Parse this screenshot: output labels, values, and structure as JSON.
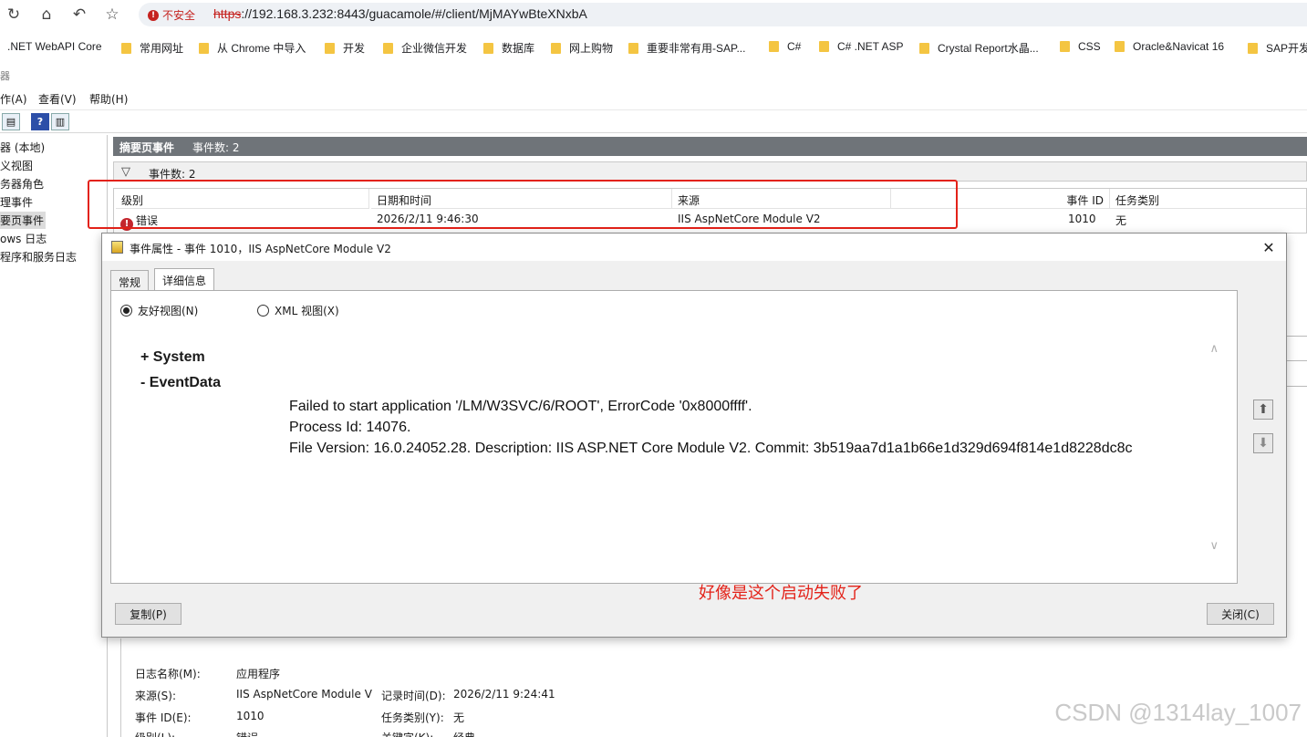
{
  "browser": {
    "insecure_label": "不安全",
    "url_scheme": "https",
    "url_rest": "://192.168.3.232:8443/guacamole/#/client/MjMAYwBteXNxbA",
    "bookmarks": [
      ".NET WebAPI Core",
      "常用网址",
      "从 Chrome 中导入",
      "开发",
      "企业微信开发",
      "数据库",
      "网上购物",
      "重要非常有用-SAP...",
      "C#",
      "C# .NET ASP",
      "Crystal Report水晶...",
      "CSS",
      "Oracle&Navicat 16",
      "SAP开发"
    ]
  },
  "event_viewer": {
    "title_fragment": "器",
    "menu": [
      "作(A)",
      "查看(V)",
      "帮助(H)"
    ],
    "tree": [
      "器 (本地)",
      "义视图",
      "务器角色",
      "理事件",
      "要页事件",
      "ows 日志",
      "程序和服务日志"
    ],
    "summary": {
      "title": "摘要页事件",
      "count_label": "事件数: 2"
    },
    "filter_text": "事件数: 2",
    "columns": [
      "级别",
      "日期和时间",
      "来源",
      "事件 ID",
      "任务类别"
    ],
    "row": {
      "level": "错误",
      "datetime": "2026/2/11 9:46:30",
      "source": "IIS AspNetCore Module V2",
      "event_id": "1010",
      "task": "无"
    }
  },
  "dialog": {
    "title": "事件属性 - 事件 1010，IIS AspNetCore Module V2",
    "tabs": [
      "常规",
      "详细信息"
    ],
    "radio_friendly": "友好视图(N)",
    "radio_xml": "XML 视图(X)",
    "node_system": "+  System",
    "node_eventdata": "-  EventData",
    "lines": [
      "Failed to start application '/LM/W3SVC/6/ROOT', ErrorCode '0x8000ffff'.",
      "Process Id: 14076.",
      "File Version: 16.0.24052.28. Description: IIS ASP.NET Core Module V2. Commit: 3b519aa7d1a1b66e1d329d694f814e1d8228dc8c"
    ],
    "copy_button": "复制(P)",
    "close_button": "关闭(C)"
  },
  "annotation": "好像是这个启动失败了",
  "preview": {
    "log_name_label": "日志名称(M):",
    "log_name_value": "应用程序",
    "source_label": "来源(S):",
    "source_value": "IIS AspNetCore Module V",
    "logged_label": "记录时间(D):",
    "logged_value": "2026/2/11 9:24:41",
    "event_id_label": "事件 ID(E):",
    "event_id_value": "1010",
    "task_label": "任务类别(Y):",
    "task_value": "无",
    "level_label": "级别(L):",
    "level_value": "错误",
    "keywords_label": "关键字(K):",
    "keywords_value": "经典"
  },
  "watermark": "CSDN @1314lay_1007",
  "colors": {
    "accent_red": "#e32219",
    "header_gray": "#6f7479",
    "error_red": "#c4262e"
  }
}
